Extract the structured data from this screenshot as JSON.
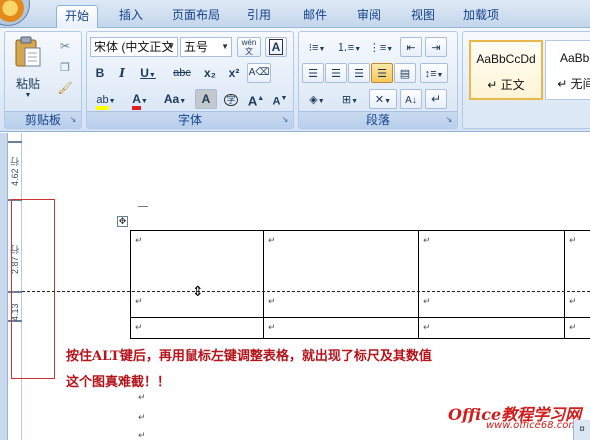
{
  "ribbon_tabs": [
    "开始",
    "插入",
    "页面布局",
    "引用",
    "邮件",
    "审阅",
    "视图",
    "加载项"
  ],
  "clipboard": {
    "paste_label": "粘贴",
    "group_label": "剪贴板"
  },
  "font": {
    "font_name": "宋体 (中文正文",
    "font_size": "五号",
    "wen_label": "wén\n文",
    "a_box_label": "A",
    "bold": "B",
    "italic": "I",
    "underline": "U",
    "strike": "abc",
    "subscript": "x₂",
    "superscript": "x²",
    "highlight": "ab",
    "font_color": "A",
    "change_case": "Aa",
    "char_shading": "A",
    "enclose": "字",
    "grow": "A",
    "shrink": "A",
    "group_label": "字体"
  },
  "paragraph": {
    "group_label": "段落"
  },
  "styles": [
    {
      "sample": "AaBbCcDd",
      "name": "↵ 正文"
    },
    {
      "sample": "AaBbCc",
      "name": "↵ 无间隔"
    }
  ],
  "ruler": {
    "label_top": "4.62 行",
    "label_mid": "2.87 行",
    "label_bot": "4.13"
  },
  "caption_line1": "按住ALT键后，再用鼠标左键调整表格，就出现了标尺及其数值",
  "caption_line2": "这个图真难截！！",
  "cell_mark": "↵",
  "para_mark": "↵",
  "watermark": "Office教程学习网",
  "watermark_url": "www.office68.com"
}
